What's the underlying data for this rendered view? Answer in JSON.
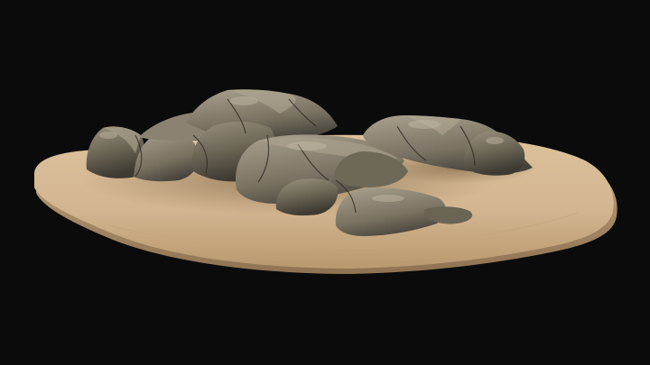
{
  "scene": {
    "subject": "rock-formation-on-sand-island",
    "background_color": "#0b0b0b",
    "sand_color": "#d5b893",
    "sand_shadow_color": "#a88c6b",
    "rock_color": "#77705f",
    "rock_light_color": "#9b9382",
    "rock_dark_color": "#3b372f"
  }
}
